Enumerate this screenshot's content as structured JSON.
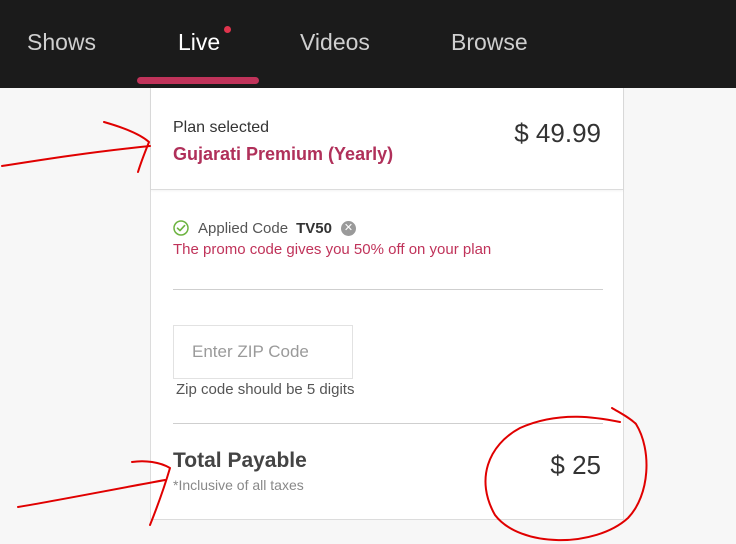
{
  "nav": {
    "tabs": [
      {
        "label": "Shows"
      },
      {
        "label": "Live",
        "active": true,
        "has_dot": true
      },
      {
        "label": "Videos"
      },
      {
        "label": "Browse"
      }
    ]
  },
  "plan": {
    "label": "Plan selected",
    "name": "Gujarati Premium (Yearly)",
    "price": "$ 49.99"
  },
  "promo": {
    "applied_label": "Applied Code",
    "code": "TV50",
    "message": "The promo code gives you 50% off on your plan"
  },
  "zip": {
    "placeholder": "Enter ZIP Code",
    "value": "",
    "hint": "Zip code should be 5 digits"
  },
  "total": {
    "label": "Total Payable",
    "note": "*Inclusive of all taxes",
    "price": "$ 25"
  },
  "colors": {
    "accent": "#c0335a",
    "nav_bg": "#1b1b1b",
    "annotation": "#e00000"
  }
}
